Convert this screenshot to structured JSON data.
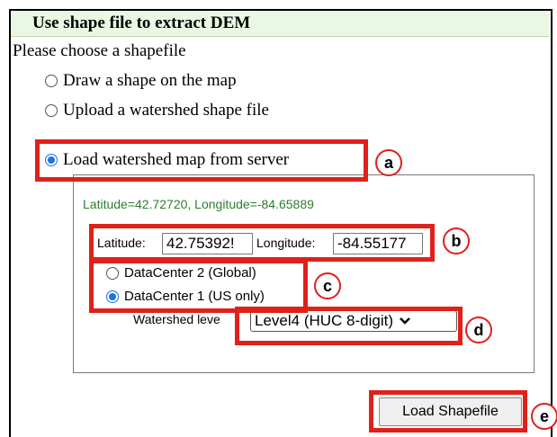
{
  "dialog": {
    "title": "Use shape file to extract DEM",
    "prompt": "Please choose a shapefile",
    "options": [
      {
        "label": "Draw a shape on the map",
        "checked": false
      },
      {
        "label": "Upload a watershed shape file",
        "checked": false
      },
      {
        "label": "Load watershed map from server",
        "checked": true
      }
    ]
  },
  "server_panel": {
    "coords_text": "Latitude=42.72720, Longitude=-84.65889",
    "latitude_label": "Latitude:",
    "latitude_value": "42.75392!",
    "longitude_label": "Longitude:",
    "longitude_value": "-84.55177",
    "datacenters": [
      {
        "label": "DataCenter 2 (Global)",
        "checked": false
      },
      {
        "label": "DataCenter 1 (US only)",
        "checked": true
      }
    ],
    "watershed_label": "Watershed leve",
    "watershed_value": "Level4 (HUC 8-digit)",
    "load_button": "Load Shapefile"
  },
  "callouts": {
    "a": "a",
    "b": "b",
    "c": "c",
    "d": "d",
    "e": "e"
  },
  "colors": {
    "annotation_red": "#e0201a",
    "header_green": "#eaf8e3",
    "coord_green": "#2e7d2e",
    "radio_blue": "#1a73e8"
  }
}
